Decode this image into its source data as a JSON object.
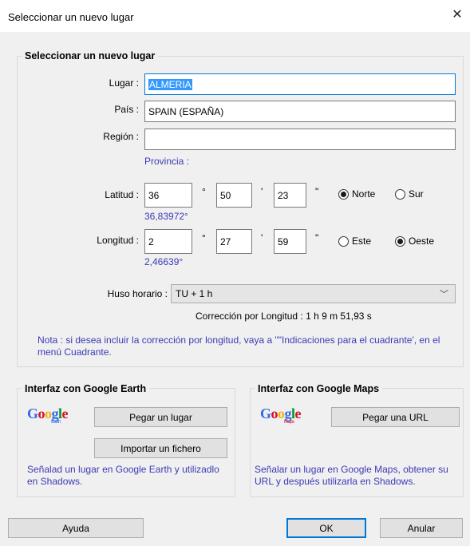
{
  "window": {
    "title": "Seleccionar un nuevo lugar",
    "close_icon": "close-icon"
  },
  "place_group": {
    "title": "Seleccionar un nuevo lugar",
    "lugar_label": "Lugar :",
    "lugar_value": "ALMERIA",
    "pais_label": "País :",
    "pais_value": "SPAIN (ESPAÑA)",
    "region_label": "Región :",
    "region_value": "",
    "provincia_label": "Provincia :",
    "latitud": {
      "label": "Latitud :",
      "deg": "36",
      "min": "50",
      "sec": "23",
      "deg_sym": "°",
      "min_sym": "'",
      "sec_sym": "\"",
      "decimal": "36,83972°",
      "opt1": "Norte",
      "opt2": "Sur",
      "selected": "Norte"
    },
    "longitud": {
      "label": "Longitud :",
      "deg": "2",
      "min": "27",
      "sec": "59",
      "deg_sym": "°",
      "min_sym": "'",
      "sec_sym": "\"",
      "decimal": "2,46639°",
      "opt1": "Este",
      "opt2": "Oeste",
      "selected": "Oeste"
    },
    "huso_label": "Huso horario :",
    "huso_value": "TU + 1 h",
    "correccion": "Corrección por Longitud : 1 h 9 m 51,93 s",
    "nota": "Nota : si desea incluir la corrección por longitud, vaya a \"\"Indicaciones para el cuadrante', en el menú Cuadrante."
  },
  "earth_group": {
    "title": "Interfaz con Google Earth",
    "logo_text": "Google",
    "logo_sub": "Earth",
    "paste_button": "Pegar un lugar",
    "import_button": "Importar un fichero",
    "help": "Señalad un lugar en Google Earth y utilizadlo en Shadows."
  },
  "maps_group": {
    "title": "Interfaz con Google Maps",
    "logo_text": "Google",
    "logo_sub": "Maps",
    "paste_button": "Pegar una URL",
    "help": "Señalar un lugar en Google Maps, obtener su URL y después utilizarla en Shadows."
  },
  "footer": {
    "help_button": "Ayuda",
    "ok_button": "OK",
    "cancel_button": "Anular"
  },
  "colors": {
    "accent": "#0078d7",
    "link_blue": "#3a3ab6",
    "dialog_bg": "#f0f0f0"
  }
}
